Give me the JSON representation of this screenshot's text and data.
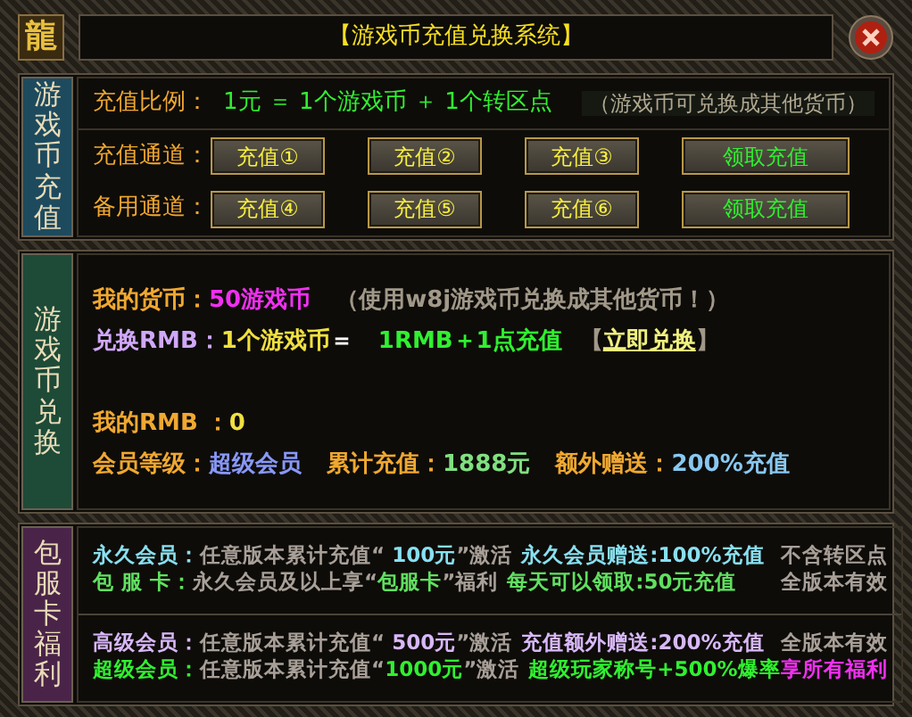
{
  "window": {
    "logo": "龍",
    "title": "【游戏币充值兑换系统】"
  },
  "recharge": {
    "tab": {
      "label": "游戏币充值",
      "color": "#1e4a5e"
    },
    "ratio": {
      "label": "充值比例：",
      "value": "1元 ＝ 1个游戏币 ＋ 1个转区点",
      "note": "（游戏币可兑换成其他货币）"
    },
    "channels": [
      {
        "label": "充值通道：",
        "buttons": [
          {
            "label": "充值①",
            "kind": "pay"
          },
          {
            "label": "充值②",
            "kind": "pay"
          },
          {
            "label": "充值③",
            "kind": "pay"
          },
          {
            "label": "领取充值",
            "kind": "claim"
          }
        ]
      },
      {
        "label": "备用通道：",
        "buttons": [
          {
            "label": "充值④",
            "kind": "pay"
          },
          {
            "label": "充值⑤",
            "kind": "pay"
          },
          {
            "label": "充值⑥",
            "kind": "pay"
          },
          {
            "label": "领取充值",
            "kind": "claim"
          }
        ]
      }
    ]
  },
  "exchange": {
    "tab": {
      "label": "游戏币兑换",
      "color": "#1e4a38"
    },
    "lines": [
      [
        {
          "text": "我的货币：",
          "color": "#f0a830"
        },
        {
          "text": "50游戏币",
          "color": "#f030f0"
        },
        {
          "text": "（使用w8j游戏币兑换成其他货币！）",
          "color": "#a09888",
          "kind": "note"
        }
      ],
      [
        {
          "text": "兑换RMB：",
          "color": "#d0a8f8"
        },
        {
          "text": "1个游戏币",
          "color": "#f0e040"
        },
        {
          "text": "＝",
          "color": "#ffffff"
        },
        {
          "text": "1RMB＋1点充值",
          "color": "#30f030",
          "kind": "note"
        },
        {
          "text": "【",
          "color": "#a09888",
          "kind": "bracket"
        },
        {
          "text": "立即兑换",
          "color": "#f0f080",
          "kind": "link"
        },
        {
          "text": "】",
          "color": "#a09888"
        }
      ],
      [
        {
          "text": "我的RMB ：",
          "color": "#f0a830",
          "kind": "gap"
        },
        {
          "text": "0",
          "color": "#f0e040"
        }
      ],
      [
        {
          "text": "会员等级：",
          "color": "#f0a830"
        },
        {
          "text": "超级会员",
          "color": "#8898f8"
        },
        {
          "text": "累计充值：",
          "color": "#f0a830",
          "kind": "note"
        },
        {
          "text": "1888元",
          "color": "#80e080"
        },
        {
          "text": "额外赠送：",
          "color": "#f0a830",
          "kind": "note"
        },
        {
          "text": "200%充值",
          "color": "#88c8f0"
        }
      ]
    ]
  },
  "benefits": {
    "tab": {
      "label": "包服卡福利",
      "color": "#4a2448"
    },
    "groups": [
      [
        [
          {
            "text": "永久会员：",
            "color": "#88e0f0"
          },
          {
            "parts": [
              {
                "text": "任意版本累计充值“ ",
                "color": "#a8a098"
              },
              {
                "text": "100元",
                "color": "#88e0f0"
              },
              {
                "text": "”激活",
                "color": "#a8a098"
              }
            ]
          },
          {
            "text": "永久会员赠送:100%充值",
            "color": "#88e0f0"
          },
          {
            "text": "不含转区点",
            "color": "#a8a098"
          }
        ],
        [
          {
            "text": "包 服 卡：",
            "color": "#60e060"
          },
          {
            "parts": [
              {
                "text": "永久会员及以上享“",
                "color": "#a8a098"
              },
              {
                "text": "包服卡",
                "color": "#60e060"
              },
              {
                "text": "”福利",
                "color": "#a8a098"
              }
            ]
          },
          {
            "text": "每天可以领取:50元充值",
            "color": "#60e060"
          },
          {
            "text": "全版本有效",
            "color": "#a8a098"
          }
        ]
      ],
      [
        [
          {
            "text": "高级会员：",
            "color": "#d8b8f8"
          },
          {
            "parts": [
              {
                "text": "任意版本累计充值“ ",
                "color": "#a8a098"
              },
              {
                "text": "500元",
                "color": "#d8b8f8"
              },
              {
                "text": "”激活",
                "color": "#a8a098"
              }
            ]
          },
          {
            "text": "充值额外赠送:200%充值",
            "color": "#d8b8f8"
          },
          {
            "text": "全版本有效",
            "color": "#a8a098"
          }
        ],
        [
          {
            "text": "超级会员：",
            "color": "#30f030"
          },
          {
            "parts": [
              {
                "text": "任意版本累计充值“",
                "color": "#a8a098"
              },
              {
                "text": "1000元",
                "color": "#30f030"
              },
              {
                "text": "”激活",
                "color": "#a8a098"
              }
            ]
          },
          {
            "text": "超级玩家称号+500%爆率",
            "color": "#30f030"
          },
          {
            "text": "享所有福利",
            "color": "#f030f0"
          }
        ]
      ]
    ]
  }
}
